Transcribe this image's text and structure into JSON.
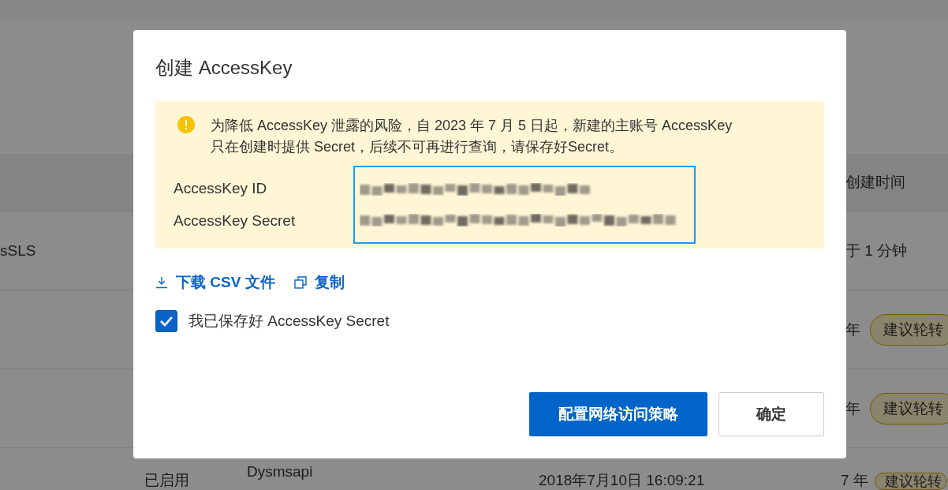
{
  "background_table": {
    "header": {
      "column_5": "创建时间"
    },
    "rows": [
      {
        "column_1": "sSLS",
        "column_5": "于 1 分钟"
      },
      {
        "column_5": "年",
        "badge": "建议轮转"
      },
      {
        "column_5": "年",
        "badge": "建议轮转"
      },
      {
        "column_2": "已启用",
        "column_3": "Dysmsapi",
        "column_4": "2018年7月10日 16:09:21",
        "column_5": "7 年",
        "badge": "建议轮转"
      }
    ]
  },
  "dialog": {
    "title": "创建 AccessKey",
    "notice": "为降低 AccessKey 泄露的风险，自 2023 年 7 月 5 日起，新建的主账号 AccessKey 只在创建时提供 Secret，后续不可再进行查询，请保存好Secret。",
    "fields": [
      {
        "label": "AccessKey ID"
      },
      {
        "label": "AccessKey Secret"
      }
    ],
    "links": [
      {
        "label": "下载 CSV 文件"
      },
      {
        "label": "复制"
      }
    ],
    "checkbox": {
      "label": "我已保存好 AccessKey Secret",
      "checked": true
    },
    "buttons": [
      {
        "label": "配置网络访问策略",
        "kind": "primary"
      },
      {
        "label": "确定",
        "kind": "default"
      }
    ]
  }
}
